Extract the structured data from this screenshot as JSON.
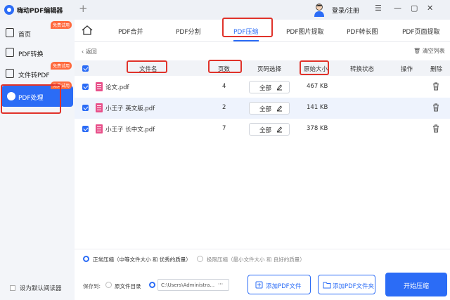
{
  "titlebar": {
    "app_title": "嗨动PDF编辑器",
    "new_tab_symbol": "+",
    "login_label": "登录/注册",
    "minimize": "—",
    "restore": "▢",
    "close": "✕",
    "menu": "☰"
  },
  "sidebar": {
    "items": [
      {
        "label": "首页",
        "badge": "免费试用"
      },
      {
        "label": "PDF转换",
        "badge": ""
      },
      {
        "label": "文件转PDF",
        "badge": "免费试用"
      },
      {
        "label": "PDF处理",
        "badge": "免费试用"
      }
    ],
    "default_reader": "设为默认阅读器"
  },
  "tabs": [
    "PDF合并",
    "PDF分割",
    "PDF压缩",
    "PDF图片提取",
    "PDF转长图",
    "PDF页面提取"
  ],
  "active_tab": "PDF压缩",
  "toolbar": {
    "back": "返回",
    "clear": "清空列表"
  },
  "table": {
    "headers": {
      "name": "文件名",
      "pages": "页数",
      "page_select": "页码选择",
      "orig_size": "原始大小",
      "status": "转换状态",
      "action": "操作",
      "delete": "删除"
    },
    "rows": [
      {
        "name": "论文.pdf",
        "pages": "4",
        "select": "全部",
        "size": "467 KB"
      },
      {
        "name": "小王子 英文版.pdf",
        "pages": "2",
        "select": "全部",
        "size": "141 KB"
      },
      {
        "name": "小王子 长中文.pdf",
        "pages": "7",
        "select": "全部",
        "size": "378 KB"
      }
    ]
  },
  "options": {
    "normal": "正常压缩（中等文件大小 和 优秀的质量）",
    "extreme": "极限压缩（最小文件大小 和 良好的质量）"
  },
  "footer": {
    "save_to": "保存到:",
    "original_dir": "原文件目录",
    "path": "C:\\Users\\Administra...",
    "path_more": "···",
    "add_file": "添加PDF文件",
    "add_folder": "添加PDF文件夹",
    "start": "开始压缩"
  },
  "colors": {
    "accent": "#2b6cf6",
    "badge": "#ff6a3d",
    "highlight": "#e0322a"
  }
}
